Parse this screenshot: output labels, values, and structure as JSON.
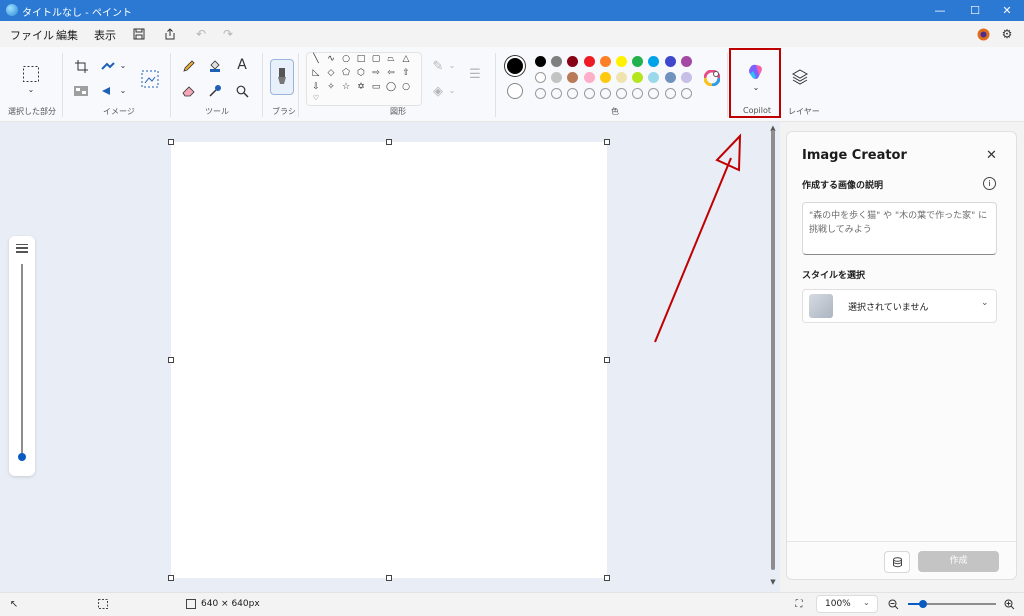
{
  "window": {
    "title": "タイトルなし - ペイント",
    "controls": {
      "minimize": "—",
      "maximize": "☐",
      "close": "✕"
    }
  },
  "menu": {
    "file": "ファイル",
    "edit": "編集",
    "view": "表示"
  },
  "ribbon": {
    "groups": {
      "selection": "選択した部分",
      "image": "イメージ",
      "tools": "ツール",
      "brushes": "ブラシ",
      "shapes": "図形",
      "colors": "色",
      "copilot": "Copilot",
      "layers": "レイヤー"
    },
    "tool_glyphs": {
      "text": "A"
    },
    "colors": {
      "primary": "#000000",
      "secondary": "#ffffff",
      "row1": [
        "#000000",
        "#7f7f7f",
        "#880015",
        "#ed1c24",
        "#ff7f27",
        "#fff200",
        "#22b14c",
        "#00a2e8",
        "#3f48cc",
        "#a349a4"
      ],
      "row2": [
        "#ffffff",
        "#c3c3c3",
        "#b97a57",
        "#ffaec9",
        "#ffc90e",
        "#efe4b0",
        "#b5e61d",
        "#99d9ea",
        "#7092be",
        "#c8bfe7"
      ]
    }
  },
  "image_creator": {
    "title": "Image Creator",
    "description_label": "作成する画像の説明",
    "prompt_placeholder": "\"森の中を歩く猫\" や \"木の葉で作った家\" に挑戦してみよう",
    "style_label": "スタイルを選択",
    "style_value": "選択されていません",
    "create_button": "作成"
  },
  "status": {
    "canvas_size": "640 × 640px",
    "zoom": "100%"
  },
  "annotation": {
    "color": "#c00000"
  }
}
